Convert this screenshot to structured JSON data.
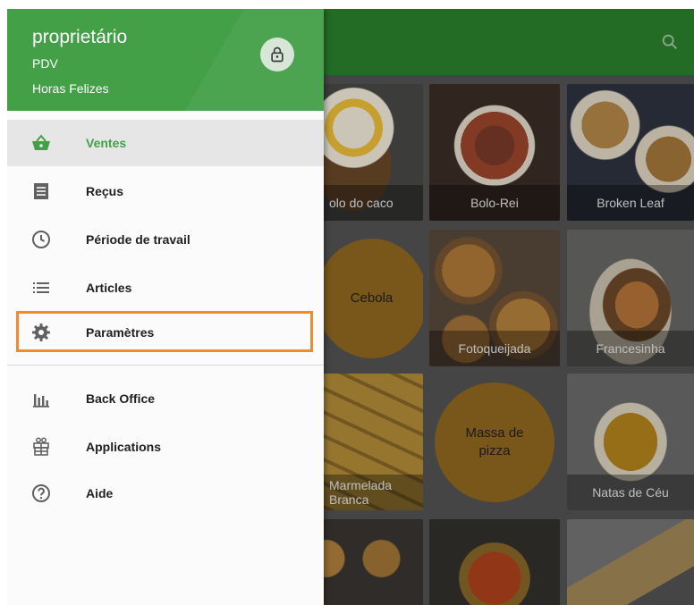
{
  "drawer": {
    "title": "proprietário",
    "subtitle1": "PDV",
    "subtitle2": "Horas Felizes",
    "lock_icon": "lock-icon",
    "items": [
      {
        "label": "Ventes",
        "icon": "basket-icon",
        "active": true
      },
      {
        "label": "Reçus",
        "icon": "receipt-icon"
      },
      {
        "label": "Période de travail",
        "icon": "clock-icon"
      },
      {
        "label": "Articles",
        "icon": "list-icon"
      },
      {
        "label": "Paramètres",
        "icon": "gear-icon",
        "highlighted": true
      },
      {
        "label": "Back Office",
        "icon": "bar-chart-icon"
      },
      {
        "label": "Applications",
        "icon": "apps-icon"
      },
      {
        "label": "Aide",
        "icon": "help-icon"
      }
    ]
  },
  "app": {
    "search_icon": "search-icon",
    "tiles": [
      {
        "label": "olo do caco"
      },
      {
        "label": "Bolo-Rei"
      },
      {
        "label": "Broken Leaf"
      },
      {
        "label": "Cebola"
      },
      {
        "label": "Fotoqueijada"
      },
      {
        "label": "Francesinha"
      },
      {
        "label": "Marmelada\nBranca"
      },
      {
        "label": "Massa de\npizza"
      },
      {
        "label": "Natas de Céu"
      }
    ]
  },
  "colors": {
    "primary": "#43a047",
    "highlight": "#f28c28",
    "text": "#212121"
  }
}
